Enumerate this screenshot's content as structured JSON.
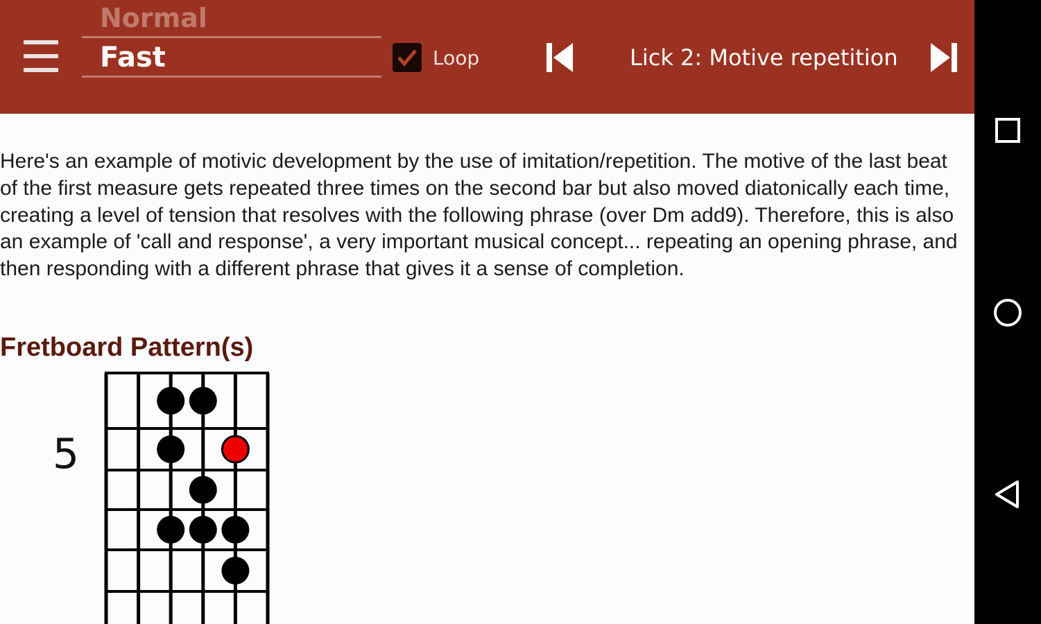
{
  "toolbar": {
    "speed_options": [
      "Normal",
      "Fast"
    ],
    "speed_previous": "Normal",
    "speed_selected": "Fast",
    "loop_label": "Loop",
    "loop_checked": true,
    "lick_title": "Lick 2: Motive repetition",
    "background_color": "#9b3221"
  },
  "icons": {
    "menu": "hamburger-menu-icon",
    "previous": "skip-previous-icon",
    "next": "skip-next-icon",
    "recents": "square-icon",
    "home": "circle-icon",
    "back": "triangle-back-icon"
  },
  "content": {
    "description": "Here's an example of motivic development by the use of imitation/repetition. The motive of the last beat of the first measure gets repeated three times on the second bar but also moved diatonically each time, creating a level of tension that resolves with the following phrase (over Dm add9). Therefore, this is also an example of 'call and response', a very important musical concept... repeating an opening phrase, and then responding with a different phrase that gives it a sense of completion.",
    "section_title": "Fretboard Pattern(s)"
  },
  "fretboard": {
    "fret_label": "5",
    "strings": 6,
    "notes": [
      {
        "fret": 1,
        "string": 3,
        "root": false
      },
      {
        "fret": 1,
        "string": 4,
        "root": false
      },
      {
        "fret": 2,
        "string": 3,
        "root": false
      },
      {
        "fret": 2,
        "string": 5,
        "root": true
      },
      {
        "fret": 3,
        "string": 4,
        "root": false
      },
      {
        "fret": 4,
        "string": 3,
        "root": false
      },
      {
        "fret": 4,
        "string": 4,
        "root": false
      },
      {
        "fret": 4,
        "string": 5,
        "root": false
      },
      {
        "fret": 5,
        "string": 5,
        "root": false
      }
    ],
    "root_color": "#ee0000",
    "note_color": "#000000"
  }
}
